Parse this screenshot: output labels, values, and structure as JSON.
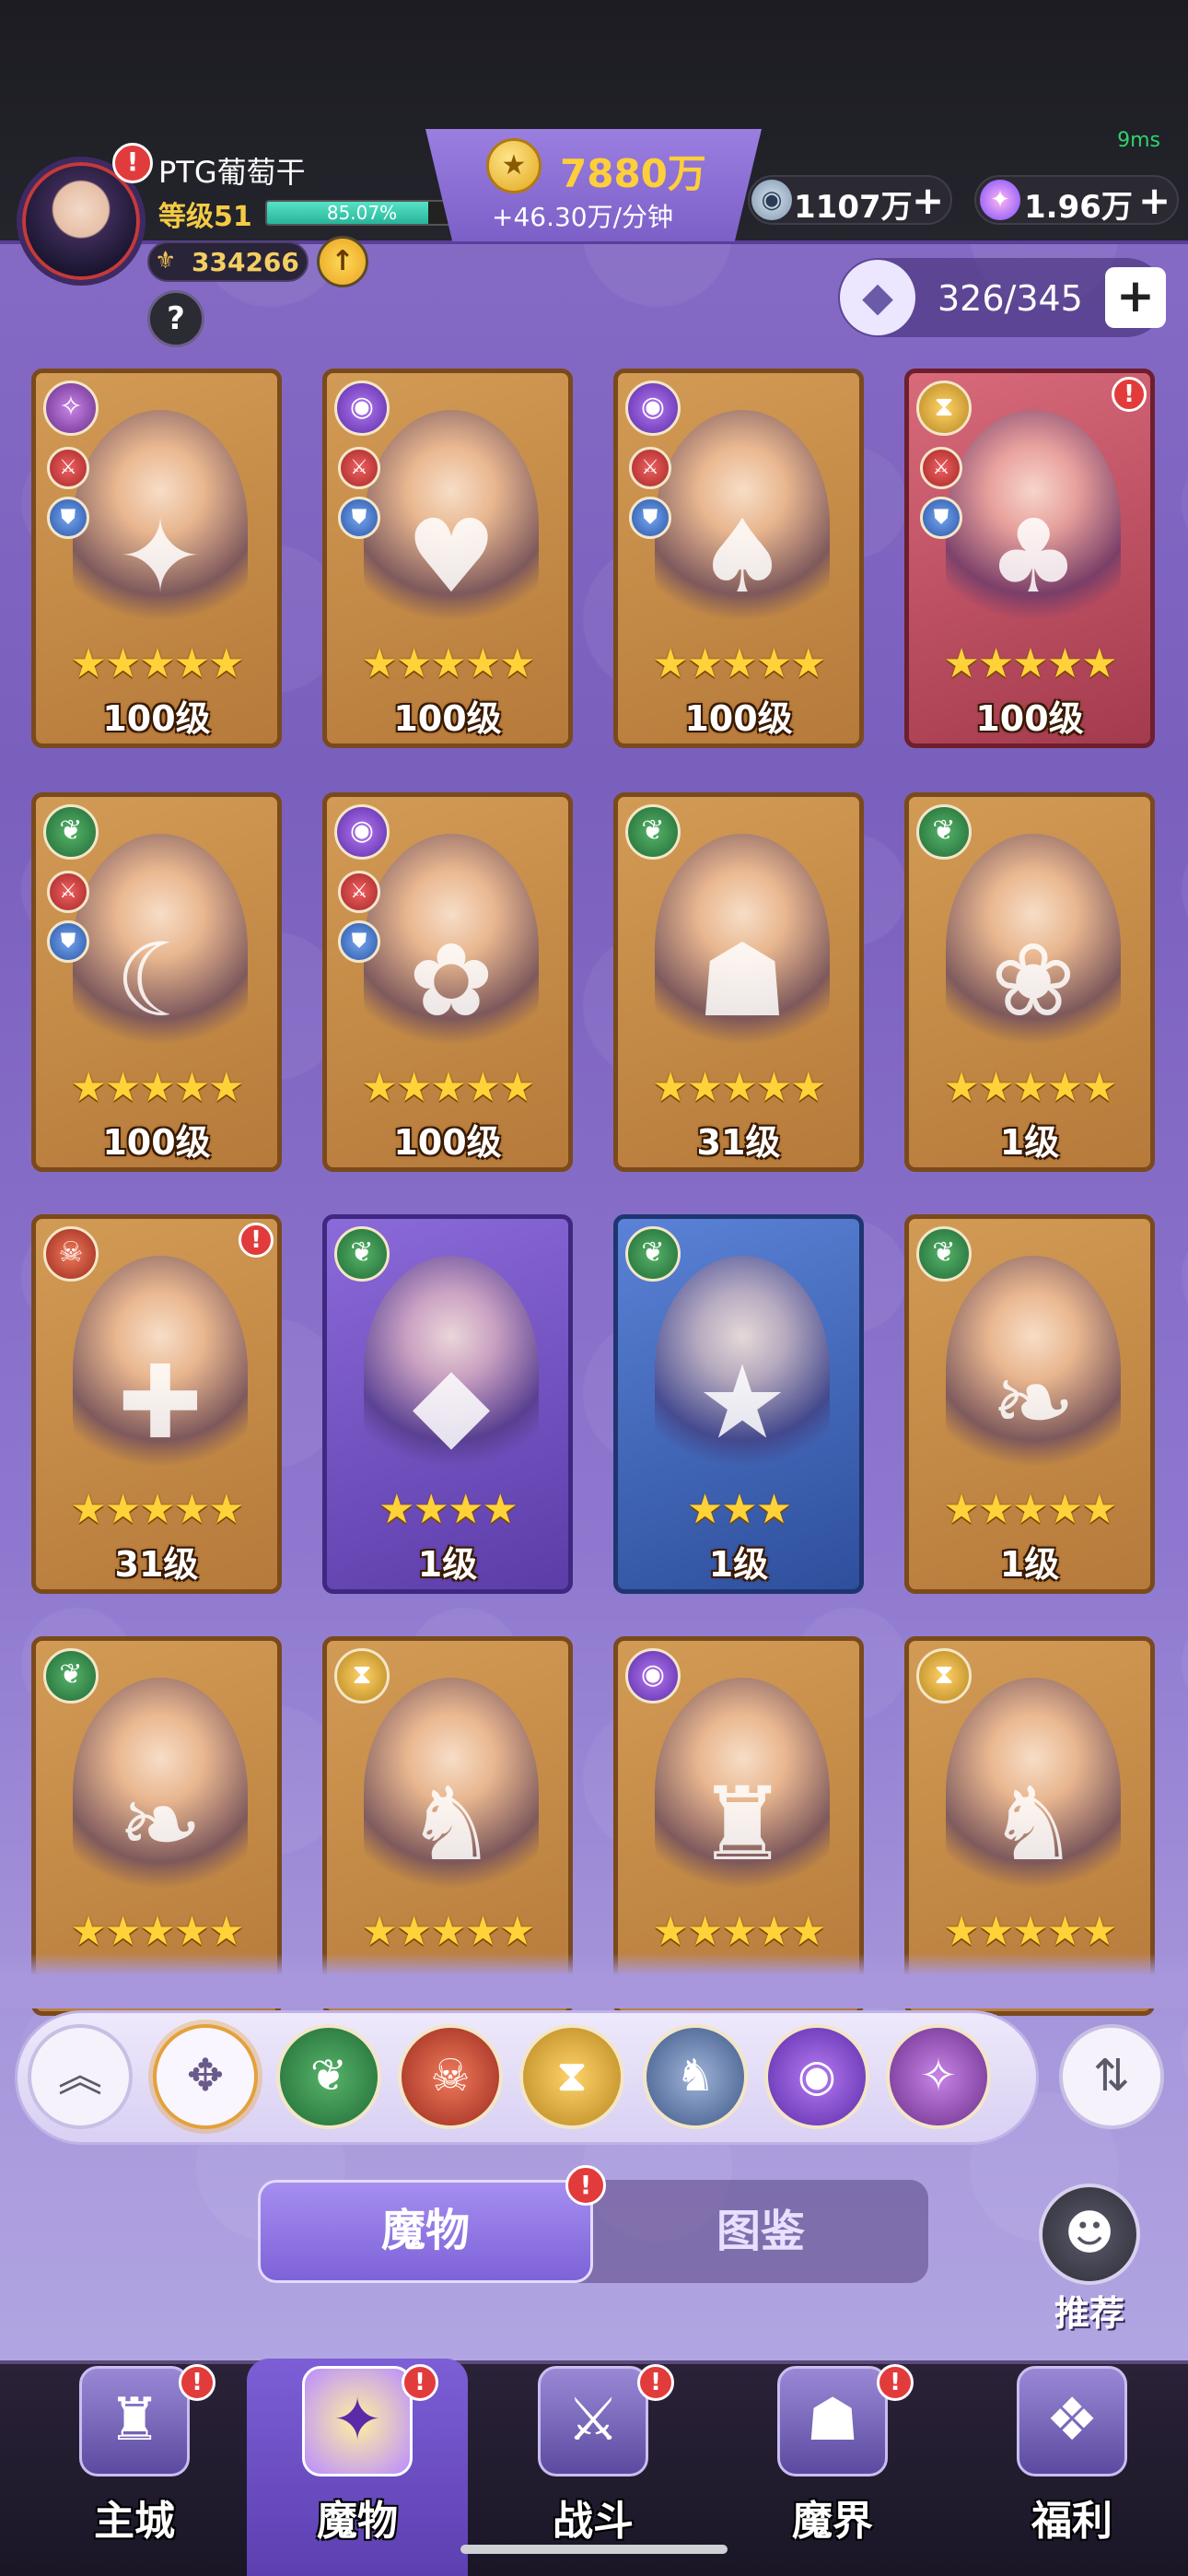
{
  "status": {
    "latency": "9ms"
  },
  "player": {
    "name": "PTG葡萄干",
    "level_label": "等级51",
    "exp_percent_text": "85.07%",
    "exp_fraction": 0.8507,
    "power": "334266",
    "power_icon": "fleur-icon",
    "up_icon": "↑",
    "help": "?",
    "avatar_badge": "!"
  },
  "gold": {
    "amount": "7880万",
    "rate": "+46.30万/分钟",
    "icon": "★"
  },
  "resources": [
    {
      "icon": "silver-coin-icon",
      "glyph": "◉",
      "value": "1107万",
      "plus": "+"
    },
    {
      "icon": "star-gem-icon",
      "glyph": "✦",
      "value": "1.96万",
      "plus": "+"
    }
  ],
  "capacity": {
    "value": "326/345",
    "add": "+",
    "icon": "cat-head-icon",
    "glyph": "◆"
  },
  "monsters": [
    {
      "faction": "chaos",
      "faction_glyph": "✧",
      "stats": true,
      "stars": "★★★★★",
      "level": "100级",
      "frame": "gold",
      "portrait": "✦",
      "dot": false
    },
    {
      "faction": "eye",
      "faction_glyph": "◉",
      "stats": true,
      "stars": "★★★★★",
      "level": "100级",
      "frame": "gold",
      "portrait": "♥",
      "dot": false
    },
    {
      "faction": "eye",
      "faction_glyph": "◉",
      "stats": true,
      "stars": "★★★★★",
      "level": "100级",
      "frame": "gold",
      "portrait": "♠",
      "dot": false
    },
    {
      "faction": "time",
      "faction_glyph": "⧗",
      "stats": true,
      "stars": "★★★★★",
      "level": "100级",
      "frame": "red",
      "portrait": "♣",
      "dot": true
    },
    {
      "faction": "nature",
      "faction_glyph": "❦",
      "stats": true,
      "stars": "★★★★★",
      "level": "100级",
      "frame": "gold",
      "portrait": "☾",
      "dot": false
    },
    {
      "faction": "eye",
      "faction_glyph": "◉",
      "stats": true,
      "stars": "★★★★★",
      "level": "100级",
      "frame": "gold",
      "portrait": "✿",
      "dot": false
    },
    {
      "faction": "nature",
      "faction_glyph": "❦",
      "stats": false,
      "stars": "★★★★★",
      "level": "31级",
      "frame": "gold",
      "portrait": "☗",
      "dot": false
    },
    {
      "faction": "nature",
      "faction_glyph": "❦",
      "stats": false,
      "stars": "★★★★★",
      "level": "1级",
      "frame": "gold",
      "portrait": "❀",
      "dot": false
    },
    {
      "faction": "demon",
      "faction_glyph": "☠",
      "stats": false,
      "stars": "★★★★★",
      "level": "31级",
      "frame": "gold",
      "portrait": "✚",
      "dot": true
    },
    {
      "faction": "nature",
      "faction_glyph": "❦",
      "stats": false,
      "stars": "★★★★",
      "level": "1级",
      "frame": "purple",
      "portrait": "◆",
      "dot": false
    },
    {
      "faction": "nature",
      "faction_glyph": "❦",
      "stats": false,
      "stars": "★★★",
      "level": "1级",
      "frame": "blue",
      "portrait": "★",
      "dot": false
    },
    {
      "faction": "nature",
      "faction_glyph": "❦",
      "stats": false,
      "stars": "★★★★★",
      "level": "1级",
      "frame": "gold",
      "portrait": "❧",
      "dot": false
    },
    {
      "faction": "nature",
      "faction_glyph": "❦",
      "stats": false,
      "stars": "★★★★★",
      "level": "",
      "frame": "gold",
      "portrait": "❧",
      "dot": false
    },
    {
      "faction": "time",
      "faction_glyph": "⧗",
      "stats": false,
      "stars": "★★★★★",
      "level": "",
      "frame": "gold",
      "portrait": "♞",
      "dot": false
    },
    {
      "faction": "eye",
      "faction_glyph": "◉",
      "stats": false,
      "stars": "★★★★★",
      "level": "",
      "frame": "gold",
      "portrait": "♜",
      "dot": false
    },
    {
      "faction": "time",
      "faction_glyph": "⧗",
      "stats": false,
      "stars": "★★★★★",
      "level": "",
      "frame": "gold",
      "portrait": "♞",
      "dot": false
    }
  ],
  "filters": {
    "collapse": "︽",
    "all": "✥",
    "nature": "❦",
    "demon": "☠",
    "time": "⧗",
    "dragon": "♞",
    "eye": "◉",
    "chaos": "✧",
    "sort": "⇅"
  },
  "tabs": {
    "active": "魔物",
    "inactive": "图鉴",
    "dot": "!"
  },
  "recommend": {
    "label": "推荐",
    "glyph": "☻"
  },
  "nav": [
    {
      "label": "主城",
      "glyph": "♜",
      "dot": "!"
    },
    {
      "label": "魔物",
      "glyph": "✦",
      "dot": "!"
    },
    {
      "label": "战斗",
      "glyph": "⚔",
      "dot": "!"
    },
    {
      "label": "魔界",
      "glyph": "☗",
      "dot": "!"
    },
    {
      "label": "福利",
      "glyph": "❖",
      "dot": ""
    }
  ]
}
